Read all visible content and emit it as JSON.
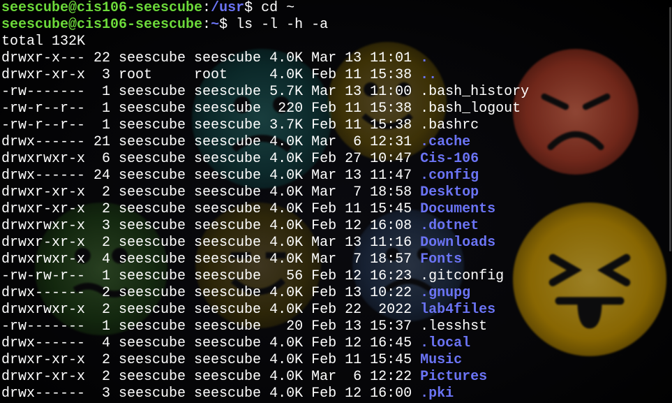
{
  "theme": {
    "user_color": "#6cd93a",
    "path_color": "#6b74f5",
    "dir_color": "#6b74f5",
    "text_color": "#ffffff",
    "background": "#000000"
  },
  "prompts": [
    {
      "user": "seescube@cis106-seescube",
      "sep": ":",
      "path": "/usr",
      "symbol": "$ ",
      "command": "cd ~"
    },
    {
      "user": "seescube@cis106-seescube",
      "sep": ":",
      "path": "~",
      "symbol": "$ ",
      "command": "ls -l -h -a"
    }
  ],
  "total_line": "total 132K",
  "entries": [
    {
      "meta": "drwxr-x--- 22 seescube seescube 4.0K Mar 13 11:01 ",
      "name": ".",
      "is_dir": true
    },
    {
      "meta": "drwxr-xr-x  3 root     root     4.0K Feb 11 15:38 ",
      "name": "..",
      "is_dir": true
    },
    {
      "meta": "-rw-------  1 seescube seescube 5.7K Mar 13 11:00 ",
      "name": ".bash_history",
      "is_dir": false
    },
    {
      "meta": "-rw-r--r--  1 seescube seescube  220 Feb 11 15:38 ",
      "name": ".bash_logout",
      "is_dir": false
    },
    {
      "meta": "-rw-r--r--  1 seescube seescube 3.7K Feb 11 15:38 ",
      "name": ".bashrc",
      "is_dir": false
    },
    {
      "meta": "drwx------ 21 seescube seescube 4.0K Mar  6 12:31 ",
      "name": ".cache",
      "is_dir": true
    },
    {
      "meta": "drwxrwxr-x  6 seescube seescube 4.0K Feb 27 10:47 ",
      "name": "Cis-106",
      "is_dir": true
    },
    {
      "meta": "drwx------ 24 seescube seescube 4.0K Mar 13 11:47 ",
      "name": ".config",
      "is_dir": true
    },
    {
      "meta": "drwxr-xr-x  2 seescube seescube 4.0K Mar  7 18:58 ",
      "name": "Desktop",
      "is_dir": true
    },
    {
      "meta": "drwxr-xr-x  2 seescube seescube 4.0K Feb 11 15:45 ",
      "name": "Documents",
      "is_dir": true
    },
    {
      "meta": "drwxrwxr-x  3 seescube seescube 4.0K Feb 12 16:08 ",
      "name": ".dotnet",
      "is_dir": true
    },
    {
      "meta": "drwxr-xr-x  2 seescube seescube 4.0K Mar 13 11:16 ",
      "name": "Downloads",
      "is_dir": true
    },
    {
      "meta": "drwxrwxr-x  4 seescube seescube 4.0K Mar  7 18:57 ",
      "name": "Fonts",
      "is_dir": true
    },
    {
      "meta": "-rw-rw-r--  1 seescube seescube   56 Feb 12 16:23 ",
      "name": ".gitconfig",
      "is_dir": false
    },
    {
      "meta": "drwx------  2 seescube seescube 4.0K Feb 13 10:22 ",
      "name": ".gnupg",
      "is_dir": true
    },
    {
      "meta": "drwxrwxr-x  2 seescube seescube 4.0K Feb 22  2022 ",
      "name": "lab4files",
      "is_dir": true
    },
    {
      "meta": "-rw-------  1 seescube seescube   20 Feb 13 15:37 ",
      "name": ".lesshst",
      "is_dir": false
    },
    {
      "meta": "drwx------  4 seescube seescube 4.0K Feb 12 16:45 ",
      "name": ".local",
      "is_dir": true
    },
    {
      "meta": "drwxr-xr-x  2 seescube seescube 4.0K Feb 11 15:45 ",
      "name": "Music",
      "is_dir": true
    },
    {
      "meta": "drwxr-xr-x  2 seescube seescube 4.0K Mar  6 12:22 ",
      "name": "Pictures",
      "is_dir": true
    },
    {
      "meta": "drwx------  3 seescube seescube 4.0K Feb 12 16:00 ",
      "name": ".pki",
      "is_dir": true
    }
  ],
  "wallpaper": {
    "icons": [
      "frown-face-icon",
      "squint-tongue-face-icon",
      "smile-face-icon",
      "sad-face-icon",
      "neutral-face-icon"
    ]
  }
}
